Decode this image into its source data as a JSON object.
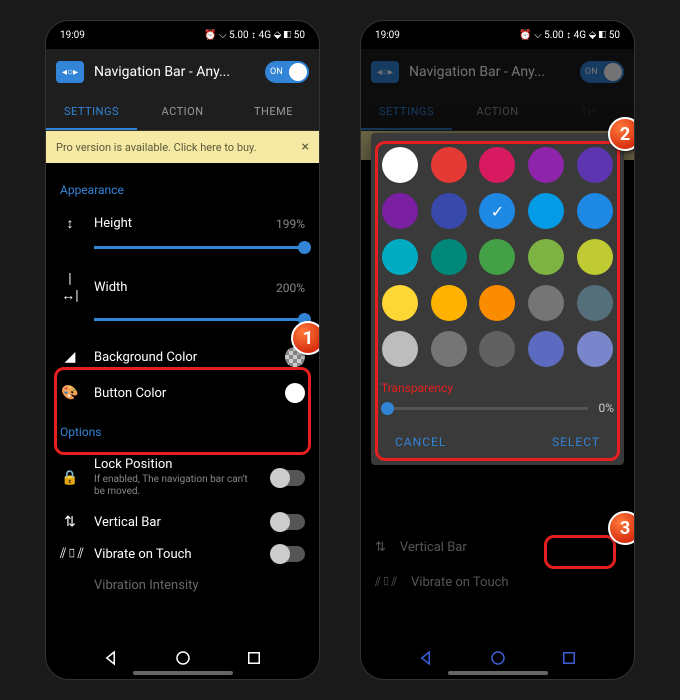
{
  "status": {
    "time": "19:09",
    "icons": "⦿ ✓ ⚡",
    "right": "⏰ ⌵ 5.00 ↕ 4G ⬙ ◧ 50"
  },
  "app": {
    "title": "Navigation Bar - Any...",
    "toggle_label": "ON"
  },
  "tabs": {
    "settings": "SETTINGS",
    "action": "ACTION",
    "theme": "THEME"
  },
  "banner": {
    "text": "Pro version is available. Click here to buy.",
    "close": "×"
  },
  "sections": {
    "appearance": "Appearance",
    "options": "Options"
  },
  "rows": {
    "height": {
      "label": "Height",
      "value": "199%"
    },
    "width": {
      "label": "Width",
      "value": "200%"
    },
    "bgcolor": {
      "label": "Background Color"
    },
    "btncolor": {
      "label": "Button Color"
    },
    "lock": {
      "label": "Lock Position",
      "sub": "If enabled, The navigation bar can't be moved."
    },
    "vertical": {
      "label": "Vertical Bar"
    },
    "vibrate": {
      "label": "Vibrate on Touch"
    },
    "vibint": {
      "label": "Vibration Intensity"
    }
  },
  "dialog": {
    "transparency": "Transparency",
    "transparency_val": "0%",
    "cancel": "CANCEL",
    "select": "SELECT",
    "colors": [
      "#ffffff",
      "#e53935",
      "#d81b60",
      "#8e24aa",
      "#5e35b1",
      "#7b1fa2",
      "#3949ab",
      "#1e88e5",
      "#039be5",
      "#1e88e5",
      "#00acc1",
      "#00897b",
      "#43a047",
      "#7cb342",
      "#c0ca33",
      "#fdd835",
      "#ffb300",
      "#fb8c00",
      "#757575",
      "#546e7a",
      "#bdbdbd",
      "#757575",
      "#616161",
      "#5c6bc0",
      "#7986cb"
    ],
    "selected_index": 7
  },
  "steps": {
    "one": "1",
    "two": "2",
    "three": "3"
  }
}
